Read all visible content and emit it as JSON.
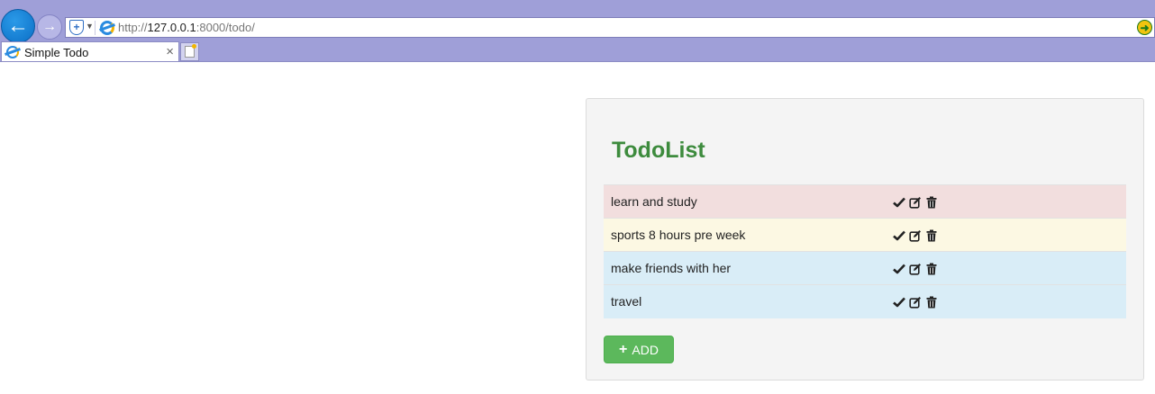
{
  "browser": {
    "url_prefix": "http://",
    "url_host": "127.0.0.1",
    "url_rest": ":8000/todo/",
    "tab_title": "Simple Todo",
    "tab_close": "×",
    "back_glyph": "←",
    "forward_glyph": "→"
  },
  "todo": {
    "title": "TodoList",
    "items": [
      {
        "text": "learn and study",
        "status": "danger"
      },
      {
        "text": "sports 8 hours pre week",
        "status": "warning"
      },
      {
        "text": "make friends with her",
        "status": "info"
      },
      {
        "text": "travel",
        "status": "info"
      }
    ],
    "item_icons": [
      "check-icon",
      "edit-icon",
      "trash-icon"
    ],
    "add_button": {
      "icon": "plus-icon",
      "plus": "+",
      "label": "ADD"
    }
  },
  "colors": {
    "title": "#3d8b3d",
    "danger_row": "#f2dede",
    "warning_row": "#fcf8e3",
    "info_row": "#d9edf7",
    "add_button": "#5cb85c",
    "chrome": "#9f9fd8"
  }
}
